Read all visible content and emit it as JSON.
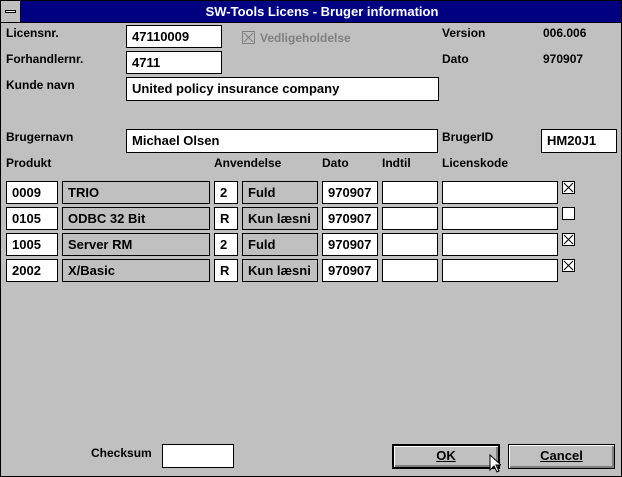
{
  "window": {
    "title": "SW-Tools Licens - Bruger information"
  },
  "labels": {
    "licensnr": "Licensnr.",
    "forhandlernr": "Forhandlernr.",
    "kunde_navn": "Kunde navn",
    "version": "Version",
    "dato": "Dato",
    "brugernavn": "Brugernavn",
    "brugerid": "BrugerID",
    "checksum": "Checksum"
  },
  "fields": {
    "licensnr": "47110009",
    "forhandlernr": "4711",
    "kunde_navn": "United policy insurance company",
    "version": "006.006",
    "dato": "970907",
    "brugernavn": "Michael Olsen",
    "brugerid": "HM20J1",
    "checksum": ""
  },
  "vedligeholdelse": {
    "label": "Vedligeholdelse",
    "checked": true,
    "disabled": true
  },
  "table": {
    "headers": {
      "produkt": "Produkt",
      "anvendelse": "Anvendelse",
      "dato": "Dato",
      "indtil": "Indtil",
      "licenskode": "Licenskode"
    },
    "rows": [
      {
        "code": "0009",
        "name": "TRIO",
        "mode": "2",
        "usage": "Fuld",
        "dato": "970907",
        "indtil": "",
        "licenskode": "",
        "checked": true
      },
      {
        "code": "0105",
        "name": "ODBC 32 Bit",
        "mode": "R",
        "usage": "Kun læsni",
        "dato": "970907",
        "indtil": "",
        "licenskode": "",
        "checked": false
      },
      {
        "code": "1005",
        "name": "Server RM",
        "mode": "2",
        "usage": "Fuld",
        "dato": "970907",
        "indtil": "",
        "licenskode": "",
        "checked": true
      },
      {
        "code": "2002",
        "name": "X/Basic",
        "mode": "R",
        "usage": "Kun læsni",
        "dato": "970907",
        "indtil": "",
        "licenskode": "",
        "checked": true
      }
    ]
  },
  "buttons": {
    "ok": "OK",
    "cancel": "Cancel"
  },
  "icons": {
    "system_menu": "system-menu-icon",
    "checkbox_check": "x-mark-icon",
    "pointer": "mouse-pointer-icon"
  },
  "colors": {
    "titlebar": "#000080",
    "face": "#c0c0c0"
  }
}
